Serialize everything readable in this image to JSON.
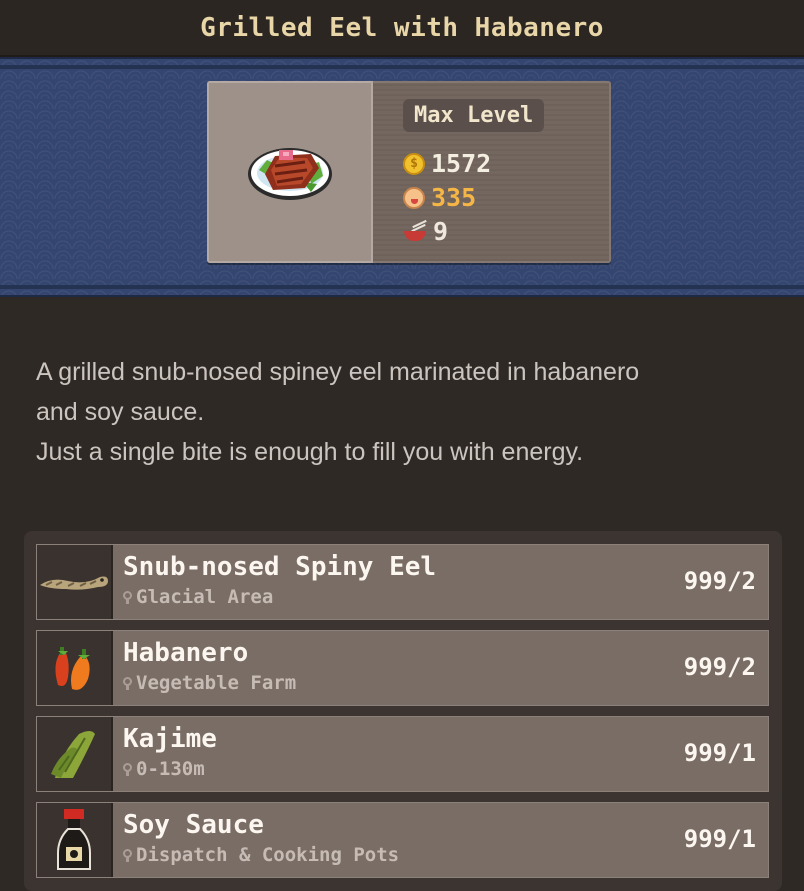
{
  "dish": {
    "name": "Grilled Eel with Habanero",
    "level_label": "Max Level",
    "coins": "1572",
    "flavor": "335",
    "servings": "9",
    "image_icon": "grilled-eel-dish-icon"
  },
  "description": [
    "A grilled snub-nosed spiney eel marinated in habanero",
    "and soy sauce.",
    "Just a single bite is enough to fill you with energy."
  ],
  "ingredients": [
    {
      "name": "Snub-nosed Spiny Eel",
      "location": "Glacial Area",
      "count": "999/2",
      "icon": "eel-icon"
    },
    {
      "name": "Habanero",
      "location": "Vegetable Farm",
      "count": "999/2",
      "icon": "habanero-icon"
    },
    {
      "name": "Kajime",
      "location": "0-130m",
      "count": "999/1",
      "icon": "seaweed-icon"
    },
    {
      "name": "Soy Sauce",
      "location": "Dispatch & Cooking Pots",
      "count": "999/1",
      "icon": "soy-sauce-bottle-icon"
    }
  ],
  "colors": {
    "banner": "#34456f",
    "panel": "#2f2925",
    "flavor_text": "#f6b646",
    "title_text": "#e9d6a8"
  }
}
